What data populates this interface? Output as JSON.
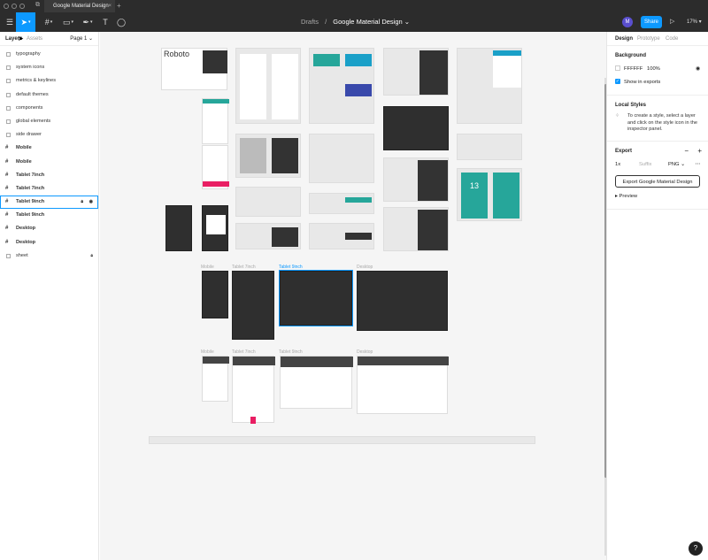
{
  "tab": {
    "title": "Google Material Design"
  },
  "toolbar": {
    "breadcrumb_parent": "Drafts",
    "breadcrumb_sep": "/",
    "document_title": "Google Material Design",
    "avatar_initial": "M",
    "share_label": "Share",
    "zoom_level": "17%"
  },
  "left_panel": {
    "tabs": [
      "Layers",
      "Assets"
    ],
    "page_selector": "Page 1",
    "layers": [
      {
        "name": "typography",
        "type": "group"
      },
      {
        "name": "system icons",
        "type": "group"
      },
      {
        "name": "metrics & keylines",
        "type": "group"
      },
      {
        "name": "default themes",
        "type": "group"
      },
      {
        "name": "components",
        "type": "group"
      },
      {
        "name": "global elements",
        "type": "group"
      },
      {
        "name": "side drawer",
        "type": "group"
      },
      {
        "name": "Mobile",
        "type": "frame"
      },
      {
        "name": "Mobile",
        "type": "frame"
      },
      {
        "name": "Tablet 7inch",
        "type": "frame"
      },
      {
        "name": "Tablet 7inch",
        "type": "frame"
      },
      {
        "name": "Tablet 9inch",
        "type": "frame",
        "selected": true
      },
      {
        "name": "Tablet 9inch",
        "type": "frame"
      },
      {
        "name": "Desktop",
        "type": "frame"
      },
      {
        "name": "Desktop",
        "type": "frame"
      },
      {
        "name": "sheet",
        "type": "group",
        "locked": true
      }
    ]
  },
  "canvas": {
    "frame_labels": {
      "mobile": "Mobile",
      "tablet7": "Tablet 7inch",
      "tablet9": "Tablet 9inch",
      "desktop": "Desktop",
      "mobile2": "Mobile",
      "tablet7b": "Tablet 7inch",
      "tablet9b": "Tablet 9inch",
      "desktop2": "Desktop"
    },
    "roboto": "Roboto",
    "calendar_day": "13"
  },
  "right_panel": {
    "tabs": [
      "Design",
      "Prototype",
      "Code"
    ],
    "background": {
      "title": "Background",
      "hex": "FFFFFF",
      "opacity": "100%",
      "show_in_exports": "Show in exports"
    },
    "local_styles": {
      "title": "Local Styles",
      "hint": "To create a style, select a layer and click on the style icon in the inspector panel."
    },
    "export": {
      "title": "Export",
      "scale": "1x",
      "suffix_placeholder": "Suffix",
      "format": "PNG",
      "button": "Export Google Material Design",
      "preview": "Preview"
    }
  },
  "colors": {
    "accent": "#0d99ff",
    "toolbar": "#2c2c2c",
    "avatar": "#5a4fcf",
    "material_pink": "#e91e63",
    "material_teal": "#26a69a"
  }
}
